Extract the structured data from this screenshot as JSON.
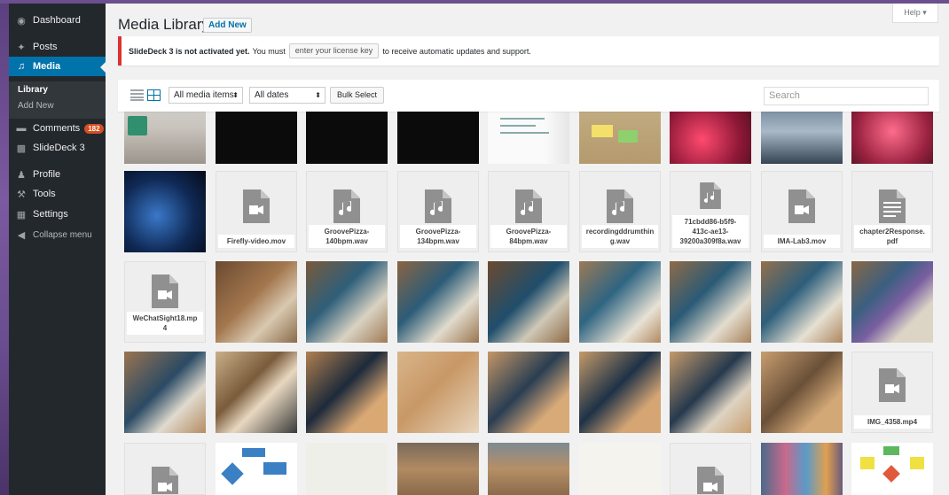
{
  "sidebar": {
    "dashboard": "Dashboard",
    "posts": "Posts",
    "media": "Media",
    "library": "Library",
    "add_new": "Add New",
    "comments": "Comments",
    "comments_count": "182",
    "slidedeck": "SlideDeck 3",
    "profile": "Profile",
    "tools": "Tools",
    "settings": "Settings",
    "collapse": "Collapse menu"
  },
  "header": {
    "title": "Media Library",
    "add_new": "Add New",
    "help": "Help ▾"
  },
  "notice": {
    "bold": "SlideDeck 3 is not activated yet.",
    "text1": "You must",
    "button": "enter your license key",
    "text2": "to receive automatic updates and support."
  },
  "toolbar": {
    "filter_type": "All media items",
    "filter_date": "All dates",
    "bulk_select": "Bulk Select",
    "search_placeholder": "Search"
  },
  "files": {
    "firefly": "Firefly-video.mov",
    "gp140": "GroovePizza-\n140bpm.wav",
    "gp134": "GroovePizza-\n134bpm.wav",
    "gp84": "GroovePizza-\n84bpm.wav",
    "recording": "recordingddrumthin\ng.wav",
    "uuid": "71cbdd86-b5f9-\n413c-ae13-\n39200a309f8a.wav",
    "imalab": "IMA-Lab3.mov",
    "chapter2": "chapter2Response.\npdf",
    "wechat": "WeChatSight18.mp\n4",
    "img4358": "IMG_4358.mp4"
  },
  "colors": {
    "sidebar_bg": "#23282d",
    "active_bg": "#0073aa",
    "notice_red": "#dc3232",
    "badge": "#d54e21"
  }
}
